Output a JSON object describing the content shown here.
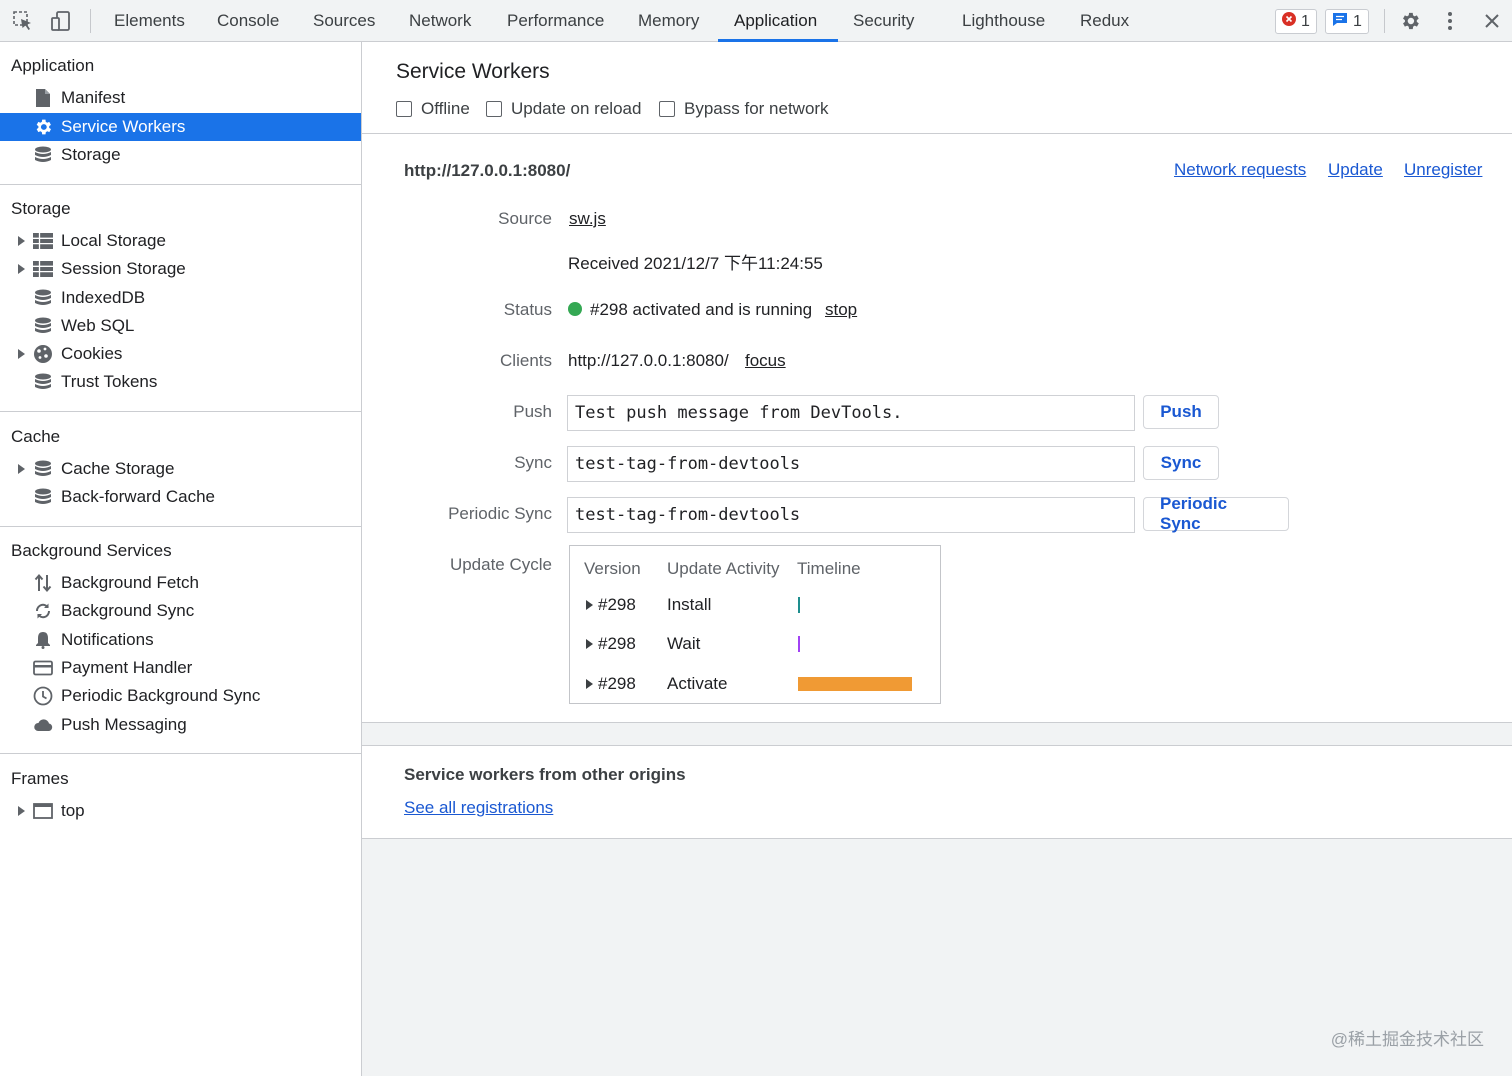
{
  "toolbar": {
    "tabs": [
      "Elements",
      "Console",
      "Sources",
      "Network",
      "Performance",
      "Memory",
      "Application",
      "Security",
      "Lighthouse",
      "Redux"
    ],
    "active_tab": "Application",
    "error_count": "1",
    "message_count": "1",
    "accent_color": "#1a73e8",
    "icons": [
      "inspect-element-icon",
      "device-toolbar-icon",
      "error-icon",
      "message-icon",
      "gear-icon",
      "more-vert-icon",
      "close-icon"
    ]
  },
  "sidebar": {
    "sections": [
      {
        "title": "Application",
        "items": [
          {
            "label": "Manifest",
            "icon": "file-icon"
          },
          {
            "label": "Service Workers",
            "icon": "gear-icon",
            "selected": true
          },
          {
            "label": "Storage",
            "icon": "database-icon"
          }
        ]
      },
      {
        "title": "Storage",
        "items": [
          {
            "label": "Local Storage",
            "icon": "grid-icon",
            "expandable": true
          },
          {
            "label": "Session Storage",
            "icon": "grid-icon",
            "expandable": true
          },
          {
            "label": "IndexedDB",
            "icon": "database-icon"
          },
          {
            "label": "Web SQL",
            "icon": "database-icon"
          },
          {
            "label": "Cookies",
            "icon": "cookie-icon",
            "expandable": true
          },
          {
            "label": "Trust Tokens",
            "icon": "database-icon"
          }
        ]
      },
      {
        "title": "Cache",
        "items": [
          {
            "label": "Cache Storage",
            "icon": "database-icon",
            "expandable": true
          },
          {
            "label": "Back-forward Cache",
            "icon": "database-icon"
          }
        ]
      },
      {
        "title": "Background Services",
        "items": [
          {
            "label": "Background Fetch",
            "icon": "up-down-arrows-icon"
          },
          {
            "label": "Background Sync",
            "icon": "sync-icon"
          },
          {
            "label": "Notifications",
            "icon": "bell-icon"
          },
          {
            "label": "Payment Handler",
            "icon": "credit-card-icon"
          },
          {
            "label": "Periodic Background Sync",
            "icon": "clock-icon"
          },
          {
            "label": "Push Messaging",
            "icon": "cloud-icon"
          }
        ]
      },
      {
        "title": "Frames",
        "items": [
          {
            "label": "top",
            "icon": "frame-icon",
            "expandable": true
          }
        ]
      }
    ]
  },
  "main": {
    "title": "Service Workers",
    "options": [
      "Offline",
      "Update on reload",
      "Bypass for network"
    ],
    "origin": "http://127.0.0.1:8080/",
    "actions": [
      "Network requests",
      "Update",
      "Unregister"
    ],
    "source_label": "Source",
    "source_link": "sw.js",
    "received": "Received 2021/12/7 下午11:24:55",
    "status_label": "Status",
    "status_text": "#298 activated and is running",
    "status_action": "stop",
    "status_color": "#34a853",
    "clients_label": "Clients",
    "clients_value": "http://127.0.0.1:8080/",
    "clients_action": "focus",
    "push_label": "Push",
    "push_value": "Test push message from DevTools.",
    "push_button": "Push",
    "sync_label": "Sync",
    "sync_value": "test-tag-from-devtools",
    "sync_button": "Sync",
    "periodic_label": "Periodic Sync",
    "periodic_value": "test-tag-from-devtools",
    "periodic_button": "Periodic Sync",
    "cycle_label": "Update Cycle",
    "cycle_headers": [
      "Version",
      "Update Activity",
      "Timeline"
    ],
    "cycle_rows": [
      {
        "version": "#298",
        "activity": "Install",
        "timeline_color": "#1e8e8e"
      },
      {
        "version": "#298",
        "activity": "Wait",
        "timeline_color": "#a142f4"
      },
      {
        "version": "#298",
        "activity": "Activate",
        "timeline_color": "#f09a34"
      }
    ],
    "other_title": "Service workers from other origins",
    "other_link": "See all registrations"
  },
  "watermark": "@稀土掘金技术社区"
}
